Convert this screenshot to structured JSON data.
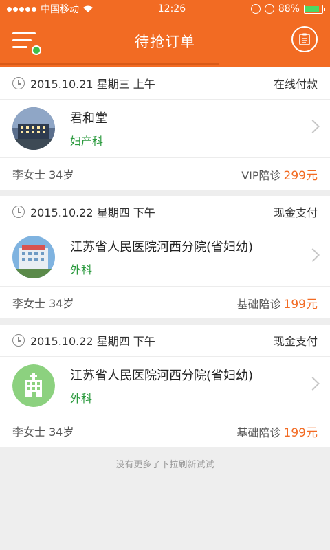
{
  "status": {
    "carrier": "中国移动",
    "time": "12:26",
    "battery": "88%"
  },
  "nav": {
    "title": "待抢订单",
    "menu_icon": "menu-icon",
    "doc_icon": "clipboard-icon",
    "accent": "#f26b23"
  },
  "orders": [
    {
      "date": "2015.10.21  星期三  上午",
      "payment": "在线付款",
      "hospital": "君和堂",
      "department": "妇产科",
      "patient": "李女士  34岁",
      "service": "VIP陪诊",
      "price": "299元"
    },
    {
      "date": "2015.10.22  星期四  下午",
      "payment": "现金支付",
      "hospital": "江苏省人民医院河西分院(省妇幼)",
      "department": "外科",
      "patient": "李女士  34岁",
      "service": "基础陪诊",
      "price": "199元"
    },
    {
      "date": "2015.10.22  星期四  下午",
      "payment": "现金支付",
      "hospital": "江苏省人民医院河西分院(省妇幼)",
      "department": "外科",
      "patient": "李女士  34岁",
      "service": "基础陪诊",
      "price": "199元"
    }
  ],
  "footer_hint": "没有更多了下拉刷新试试"
}
